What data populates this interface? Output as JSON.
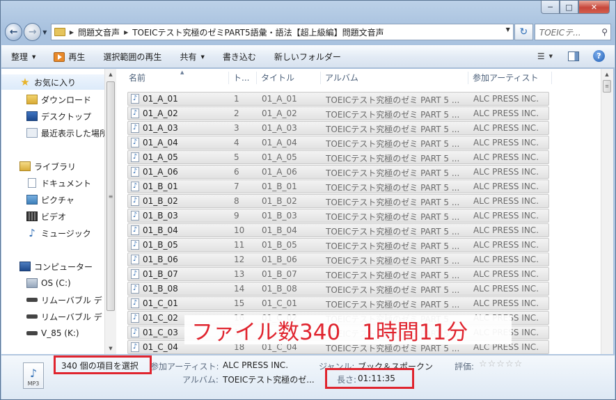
{
  "window": {
    "caption_buttons": {
      "minimize": "─",
      "maximize": "□",
      "close": "✕"
    }
  },
  "address": {
    "crumbs": [
      "問題文音声",
      "TOEICテスト究極のゼミPART5語彙・語法【超上級編】問題文音声"
    ],
    "search_placeholder": "TOEICテ..."
  },
  "toolbar": {
    "organize": "整理",
    "play": "再生",
    "play_selection": "選択範囲の再生",
    "share": "共有",
    "burn": "書き込む",
    "new_folder": "新しいフォルダー"
  },
  "nav": {
    "favorites": "お気に入り",
    "downloads": "ダウンロード",
    "desktop": "デスクトップ",
    "recent": "最近表示した場所",
    "libraries": "ライブラリ",
    "documents": "ドキュメント",
    "pictures": "ピクチャ",
    "videos": "ビデオ",
    "music": "ミュージック",
    "computer": "コンピューター",
    "os_drive": "OS (C:)",
    "removable1": "リムーバブル デ",
    "removable2": "リムーバブル デ",
    "v85": "V_85 (K:)"
  },
  "columns": {
    "name": "名前",
    "track": "ト...",
    "title": "タイトル",
    "album": "アルバム",
    "artist": "参加アーティスト"
  },
  "files": [
    {
      "name": "01_A_01",
      "track": "1",
      "title": "01_A_01",
      "album": "TOEICテスト究極のゼミ PART 5 ...",
      "artist": "ALC PRESS INC."
    },
    {
      "name": "01_A_02",
      "track": "2",
      "title": "01_A_02",
      "album": "TOEICテスト究極のゼミ PART 5 ...",
      "artist": "ALC PRESS INC."
    },
    {
      "name": "01_A_03",
      "track": "3",
      "title": "01_A_03",
      "album": "TOEICテスト究極のゼミ PART 5 ...",
      "artist": "ALC PRESS INC."
    },
    {
      "name": "01_A_04",
      "track": "4",
      "title": "01_A_04",
      "album": "TOEICテスト究極のゼミ PART 5 ...",
      "artist": "ALC PRESS INC."
    },
    {
      "name": "01_A_05",
      "track": "5",
      "title": "01_A_05",
      "album": "TOEICテスト究極のゼミ PART 5 ...",
      "artist": "ALC PRESS INC."
    },
    {
      "name": "01_A_06",
      "track": "6",
      "title": "01_A_06",
      "album": "TOEICテスト究極のゼミ PART 5 ...",
      "artist": "ALC PRESS INC."
    },
    {
      "name": "01_B_01",
      "track": "7",
      "title": "01_B_01",
      "album": "TOEICテスト究極のゼミ PART 5 ...",
      "artist": "ALC PRESS INC."
    },
    {
      "name": "01_B_02",
      "track": "8",
      "title": "01_B_02",
      "album": "TOEICテスト究極のゼミ PART 5 ...",
      "artist": "ALC PRESS INC."
    },
    {
      "name": "01_B_03",
      "track": "9",
      "title": "01_B_03",
      "album": "TOEICテスト究極のゼミ PART 5 ...",
      "artist": "ALC PRESS INC."
    },
    {
      "name": "01_B_04",
      "track": "10",
      "title": "01_B_04",
      "album": "TOEICテスト究極のゼミ PART 5 ...",
      "artist": "ALC PRESS INC."
    },
    {
      "name": "01_B_05",
      "track": "11",
      "title": "01_B_05",
      "album": "TOEICテスト究極のゼミ PART 5 ...",
      "artist": "ALC PRESS INC."
    },
    {
      "name": "01_B_06",
      "track": "12",
      "title": "01_B_06",
      "album": "TOEICテスト究極のゼミ PART 5 ...",
      "artist": "ALC PRESS INC."
    },
    {
      "name": "01_B_07",
      "track": "13",
      "title": "01_B_07",
      "album": "TOEICテスト究極のゼミ PART 5 ...",
      "artist": "ALC PRESS INC."
    },
    {
      "name": "01_B_08",
      "track": "14",
      "title": "01_B_08",
      "album": "TOEICテスト究極のゼミ PART 5 ...",
      "artist": "ALC PRESS INC."
    },
    {
      "name": "01_C_01",
      "track": "15",
      "title": "01_C_01",
      "album": "TOEICテスト究極のゼミ PART 5 ...",
      "artist": "ALC PRESS INC."
    },
    {
      "name": "01_C_02",
      "track": "16",
      "title": "01_C_02",
      "album": "TOEICテスト究極のゼミ PART 5 ...",
      "artist": "ALC PRESS INC."
    },
    {
      "name": "01_C_03",
      "track": "17",
      "title": "01_C_03",
      "album": "TOEICテスト究極のゼミ PART 5 ...",
      "artist": "ALC PRESS INC."
    },
    {
      "name": "01_C_04",
      "track": "18",
      "title": "01_C_04",
      "album": "TOEICテスト究極のゼミ PART 5 ...",
      "artist": "ALC PRESS INC."
    }
  ],
  "overlay": {
    "text": "ファイル数340　1時間11分"
  },
  "details": {
    "icon_label": "MP3",
    "selection": "340 個の項目を選択",
    "artist_label": "参加アーティスト:",
    "artist_value": "ALC PRESS INC.",
    "genre_label": "ジャンル:",
    "genre_value": "ブック＆スポークン",
    "rating_label": "評価:",
    "rating_stars": "☆☆☆☆☆",
    "album_label": "アルバム:",
    "album_value": "TOEICテスト究極のゼ...",
    "length_label": "長さ:",
    "length_value": "01:11:35"
  },
  "colors": {
    "highlight_red": "#e0242e",
    "window_frame": "#bcd1e8"
  }
}
